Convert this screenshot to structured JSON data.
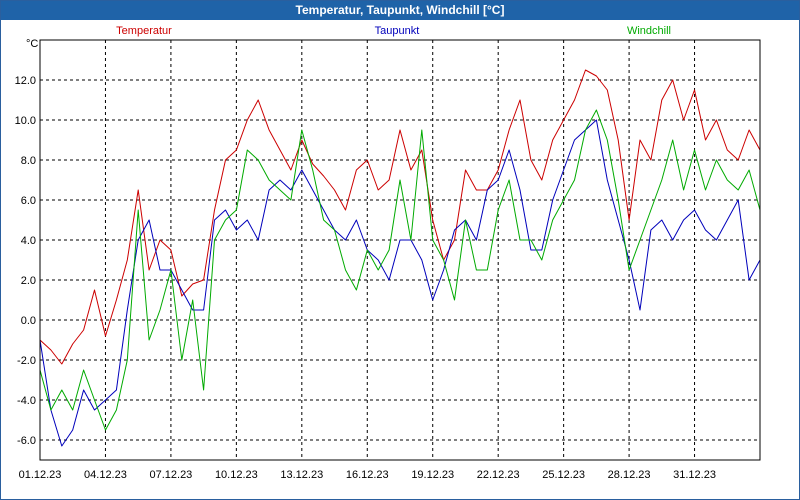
{
  "window": {
    "title": "Temperatur, Taupunkt, Windchill [°C]"
  },
  "chart_data": {
    "type": "line",
    "ylabel": "°C",
    "ylim": [
      -7,
      14
    ],
    "y_ticks": [
      "-6.0",
      "-4.0",
      "-2.0",
      "0.0",
      "2.0",
      "4.0",
      "6.0",
      "8.0",
      "10.0",
      "12.0"
    ],
    "y_tick_values": [
      -6,
      -4,
      -2,
      0,
      2,
      4,
      6,
      8,
      10,
      12
    ],
    "x_ticks": [
      "01.12.23",
      "04.12.23",
      "07.12.23",
      "10.12.23",
      "13.12.23",
      "16.12.23",
      "19.12.23",
      "22.12.23",
      "25.12.23",
      "28.12.23",
      "31.12.23"
    ],
    "x_tick_days": [
      0,
      3,
      6,
      9,
      12,
      15,
      18,
      21,
      24,
      27,
      30
    ],
    "xlim_days": [
      0,
      33
    ],
    "grid": true,
    "legend_position": "top",
    "series": [
      {
        "name": "Temperatur",
        "color": "#cc0000",
        "x_days": [
          0,
          0.5,
          1,
          1.5,
          2,
          2.5,
          3,
          3.5,
          4,
          4.5,
          5,
          5.5,
          6,
          6.5,
          7,
          7.5,
          8,
          8.5,
          9,
          9.5,
          10,
          10.5,
          11,
          11.5,
          12,
          12.5,
          13,
          13.5,
          14,
          14.5,
          15,
          15.5,
          16,
          16.5,
          17,
          17.5,
          18,
          18.5,
          19,
          19.5,
          20,
          20.5,
          21,
          21.5,
          22,
          22.5,
          23,
          23.5,
          24,
          24.5,
          25,
          25.5,
          26,
          26.5,
          27,
          27.5,
          28,
          28.5,
          29,
          29.5,
          30,
          30.5,
          31,
          31.5,
          32,
          32.5,
          33
        ],
        "values": [
          -1.0,
          -1.5,
          -2.2,
          -1.2,
          -0.5,
          1.5,
          -0.8,
          1.0,
          3.0,
          6.5,
          2.5,
          4.0,
          3.5,
          1.2,
          1.8,
          2.0,
          5.5,
          8.0,
          8.5,
          10.0,
          11.0,
          9.5,
          8.5,
          7.5,
          9.0,
          7.8,
          7.2,
          6.5,
          5.5,
          7.5,
          8.0,
          6.5,
          7.0,
          9.5,
          7.5,
          8.5,
          5.0,
          3.0,
          4.0,
          7.5,
          6.5,
          6.5,
          7.5,
          9.5,
          11.0,
          8.0,
          7.0,
          9.0,
          10.0,
          11.0,
          12.5,
          12.2,
          11.5,
          9.0,
          5.0,
          9.0,
          8.0,
          11.0,
          12.0,
          10.0,
          11.5,
          9.0,
          10.0,
          8.5,
          8.0,
          9.5,
          8.5
        ]
      },
      {
        "name": "Taupunkt",
        "color": "#0000bb",
        "x_days": [
          0,
          0.5,
          1,
          1.5,
          2,
          2.5,
          3,
          3.5,
          4,
          4.5,
          5,
          5.5,
          6,
          6.5,
          7,
          7.5,
          8,
          8.5,
          9,
          9.5,
          10,
          10.5,
          11,
          11.5,
          12,
          12.5,
          13,
          13.5,
          14,
          14.5,
          15,
          15.5,
          16,
          16.5,
          17,
          17.5,
          18,
          18.5,
          19,
          19.5,
          20,
          20.5,
          21,
          21.5,
          22,
          22.5,
          23,
          23.5,
          24,
          24.5,
          25,
          25.5,
          26,
          26.5,
          27,
          27.5,
          28,
          28.5,
          29,
          29.5,
          30,
          30.5,
          31,
          31.5,
          32,
          32.5,
          33
        ],
        "values": [
          -1.0,
          -4.5,
          -6.3,
          -5.5,
          -3.5,
          -4.5,
          -4.0,
          -3.5,
          0.5,
          4.0,
          5.0,
          2.5,
          2.5,
          1.5,
          0.5,
          0.5,
          5.0,
          5.5,
          4.5,
          5.0,
          4.0,
          6.5,
          7.0,
          6.5,
          7.5,
          6.5,
          5.5,
          4.5,
          4.0,
          5.0,
          3.5,
          3.0,
          2.0,
          4.0,
          4.0,
          3.0,
          1.0,
          2.5,
          4.5,
          5.0,
          4.0,
          6.5,
          7.0,
          8.5,
          6.5,
          3.5,
          3.5,
          6.0,
          7.5,
          9.0,
          9.5,
          10.0,
          7.0,
          5.0,
          3.0,
          0.5,
          4.5,
          5.0,
          4.0,
          5.0,
          5.5,
          4.5,
          4.0,
          5.0,
          6.0,
          2.0,
          3.0
        ]
      },
      {
        "name": "Windchill",
        "color": "#00aa00",
        "x_days": [
          0,
          0.5,
          1,
          1.5,
          2,
          2.5,
          3,
          3.5,
          4,
          4.5,
          5,
          5.5,
          6,
          6.5,
          7,
          7.5,
          8,
          8.5,
          9,
          9.5,
          10,
          10.5,
          11,
          11.5,
          12,
          12.5,
          13,
          13.5,
          14,
          14.5,
          15,
          15.5,
          16,
          16.5,
          17,
          17.5,
          18,
          18.5,
          19,
          19.5,
          20,
          20.5,
          21,
          21.5,
          22,
          22.5,
          23,
          23.5,
          24,
          24.5,
          25,
          25.5,
          26,
          26.5,
          27,
          27.5,
          28,
          28.5,
          29,
          29.5,
          30,
          30.5,
          31,
          31.5,
          32,
          32.5,
          33
        ],
        "values": [
          -2.5,
          -4.5,
          -3.5,
          -4.5,
          -2.5,
          -4.0,
          -5.5,
          -4.5,
          -2.0,
          5.5,
          -1.0,
          0.5,
          2.5,
          -2.0,
          1.0,
          -3.5,
          4.0,
          5.0,
          5.5,
          8.5,
          8.0,
          7.0,
          6.5,
          6.0,
          9.5,
          7.5,
          5.0,
          4.5,
          2.5,
          1.5,
          3.5,
          2.5,
          3.5,
          7.0,
          4.0,
          9.5,
          4.0,
          3.0,
          1.0,
          5.0,
          2.5,
          2.5,
          5.5,
          7.0,
          4.0,
          4.0,
          3.0,
          5.0,
          6.0,
          7.0,
          9.5,
          10.5,
          9.0,
          6.0,
          2.5,
          4.0,
          5.5,
          7.0,
          9.0,
          6.5,
          8.5,
          6.5,
          8.0,
          7.0,
          6.5,
          7.5,
          5.5
        ]
      }
    ]
  }
}
